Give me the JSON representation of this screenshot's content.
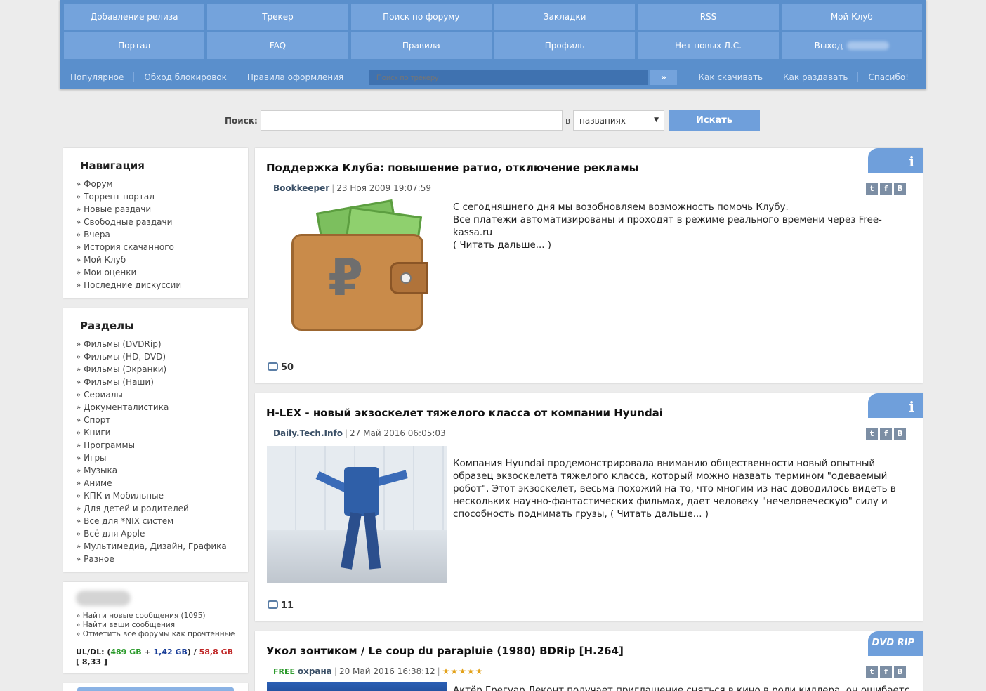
{
  "topmenu": {
    "row1": [
      "Добавление релиза",
      "Трекер",
      "Поиск по форуму",
      "Закладки",
      "RSS",
      "Мой Клуб"
    ],
    "row2": [
      "Портал",
      "FAQ",
      "Правила",
      "Профиль",
      "Нет новых Л.С.",
      "Выход"
    ],
    "sub_left": [
      "Популярное",
      "Обход блокировок",
      "Правила оформления"
    ],
    "sub_right": [
      "Как скачивать",
      "Как раздавать",
      "Спасибо!"
    ],
    "tracker_search_placeholder": "Поиск по трекеру",
    "tracker_search_go": "»"
  },
  "search": {
    "label": "Поиск:",
    "value": "",
    "in_label": "в",
    "scope": "названиях",
    "button": "Искать"
  },
  "sidebar": {
    "nav_title": "Навигация",
    "nav_items": [
      "Форум",
      "Торрент портал",
      "Новые раздачи",
      "Свободные раздачи",
      "Вчера",
      "История скачанного",
      "Мой Клуб",
      "Мои оценки",
      "Последние дискуссии"
    ],
    "sections_title": "Разделы",
    "sections": [
      "Фильмы (DVDRip)",
      "Фильмы (HD, DVD)",
      "Фильмы (Экранки)",
      "Фильмы (Наши)",
      "Сериалы",
      "Документалистика",
      "Спорт",
      "Книги",
      "Программы",
      "Игры",
      "Музыка",
      "Аниме",
      "КПК и Мобильные",
      "Для детей и родителей",
      "Все для *NIX систем",
      "Всё для Apple",
      "Мультимедиа, Дизайн, Графика",
      "Разное"
    ],
    "user_links": [
      "Найти новые сообщения (1095)",
      "Найти ваши сообщения",
      "Отметить все форумы как прочтённые"
    ],
    "ratio": {
      "label": "UL/DL:",
      "open": "(",
      "ul": "489 GB",
      "plus": "+",
      "bonus": "1,42 GB",
      "close_slash": ") /",
      "dl": "58,8 GB",
      "ratio_open": "[",
      "ratio": "8,33",
      "ratio_close": "]"
    }
  },
  "posts": [
    {
      "title": "Поддержка Клуба: повышение ратио, отключение рекламы",
      "author": "Bookkeeper",
      "date": "23 Ноя 2009 19:07:59",
      "text": "С сегодняшнего дня мы возобновляем возможность помочь Клубу.",
      "text2": "Все платежи автоматизированы и проходят в режиме реального времени через Free-kassa.ru",
      "more": "( Читать дальше... )",
      "comments": "50",
      "image_symbol": "₽",
      "badge_icon": "info-icon"
    },
    {
      "title": "H-LEX - новый экзоскелет тяжелого класса от компании Hyundai",
      "author": "Daily.Tech.Info",
      "date": "27 Май 2016 06:05:03",
      "text": "Компания Hyundai продемонстрировала вниманию общественности новый опытный образец экзоскелета тяжелого класса, который можно назвать термином \"одеваемый робот\". Этот экзоскелет, весьма похожий на то, что многим из нас доводилось видеть в нескольких научно-фантастических фильмах, дает человеку \"нечеловеческую\" силу и способность поднимать грузы, (",
      "more": "Читать дальше... )",
      "comments": "11",
      "badge_icon": "info-icon"
    },
    {
      "title": "Укол зонтиком / Le coup du parapluie (1980) BDRip [H.264]",
      "free": "FREE",
      "author": "охрана",
      "date": "20 Май 2016 16:38:12",
      "stars": "★★★★★",
      "text": "Актёр Грегуар Леконт получает приглашение сняться в кино в роли киллера, он ошибается дверью",
      "badge_text": "DVD RIP"
    }
  ],
  "share": [
    "t",
    "f",
    "B"
  ],
  "info_glyph": "i"
}
